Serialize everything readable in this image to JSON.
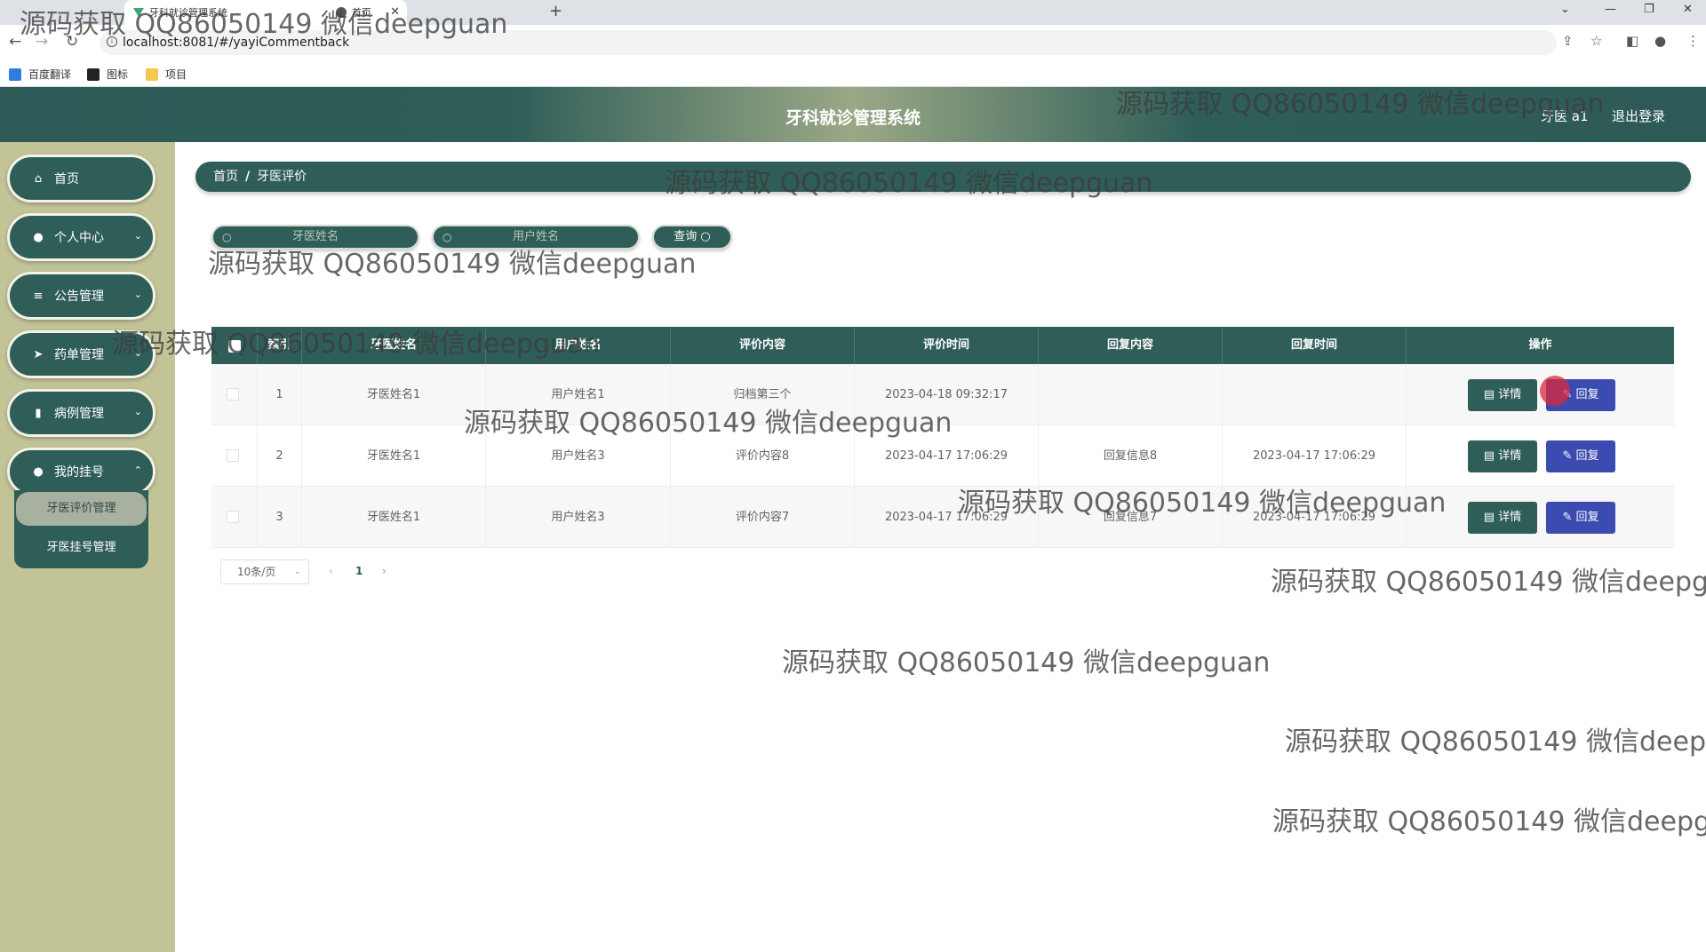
{
  "browser": {
    "tabs": [
      {
        "title": "牙科就诊管理系统"
      },
      {
        "title": "首页"
      }
    ],
    "url": "localhost:8081/#/yayiCommentback",
    "bookmarks": [
      "百度翻译",
      "图标",
      "项目"
    ]
  },
  "header": {
    "title": "牙科就诊管理系统",
    "user": "牙医 a1",
    "logout": "退出登录"
  },
  "sidebar": {
    "items": [
      {
        "label": "首页",
        "icon": "home-icon"
      },
      {
        "label": "个人中心",
        "icon": "user-icon"
      },
      {
        "label": "公告管理",
        "icon": "list-icon"
      },
      {
        "label": "药单管理",
        "icon": "send-icon"
      },
      {
        "label": "病例管理",
        "icon": "bar-chart-icon"
      },
      {
        "label": "我的挂号",
        "icon": "location-icon"
      }
    ],
    "submenu": [
      {
        "label": "牙医评价管理",
        "active": true
      },
      {
        "label": "牙医挂号管理",
        "active": false
      }
    ]
  },
  "breadcrumb": {
    "home": "首页",
    "current": "牙医评价"
  },
  "search": {
    "doctor_placeholder": "牙医姓名",
    "user_placeholder": "用户姓名",
    "query_label": "查询"
  },
  "table": {
    "headers": [
      "索引",
      "牙医姓名",
      "用户姓名",
      "评价内容",
      "评价时间",
      "回复内容",
      "回复时间",
      "操作"
    ],
    "rows": [
      {
        "index": "1",
        "doctor": "牙医姓名1",
        "user": "用户姓名1",
        "content": "归档第三个",
        "time": "2023-04-18 09:32:17",
        "reply": "",
        "reply_time": ""
      },
      {
        "index": "2",
        "doctor": "牙医姓名1",
        "user": "用户姓名3",
        "content": "评价内容8",
        "time": "2023-04-17 17:06:29",
        "reply": "回复信息8",
        "reply_time": "2023-04-17 17:06:29"
      },
      {
        "index": "3",
        "doctor": "牙医姓名1",
        "user": "用户姓名3",
        "content": "评价内容7",
        "time": "2023-04-17 17:06:29",
        "reply": "回复信息7",
        "reply_time": "2023-04-17 17:06:29"
      }
    ],
    "detail_label": "详情",
    "reply_label": "回复"
  },
  "pagination": {
    "page_size": "10条/页",
    "current_page": "1"
  },
  "watermark": "源码获取 QQ86050149 微信deepguan",
  "colors": {
    "primary": "#2f5e58",
    "sidebar_bg": "#c3c398",
    "reply_button": "#3b4bb0"
  }
}
